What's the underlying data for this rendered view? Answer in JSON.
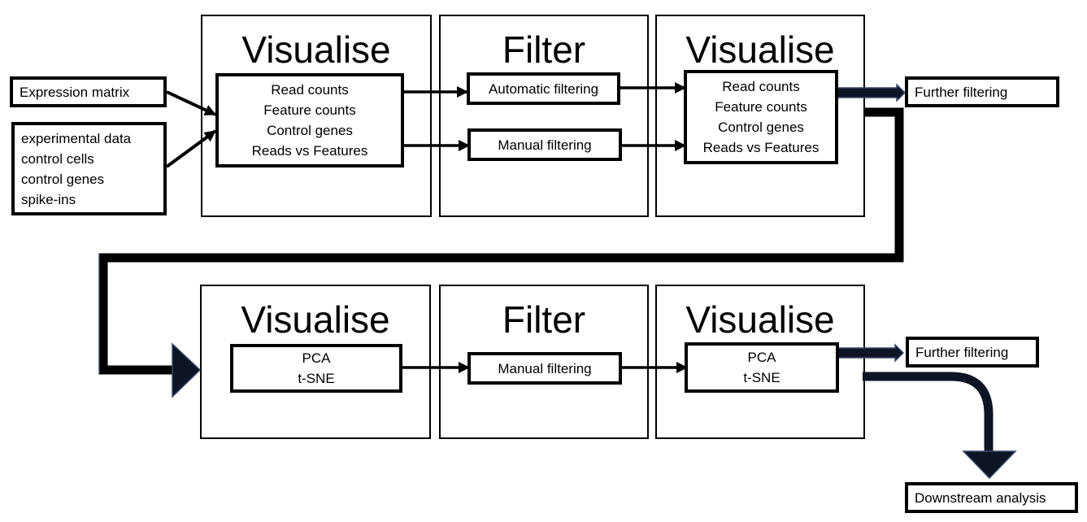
{
  "inputs": {
    "expression_matrix": "Expression matrix",
    "metadata_lines": [
      "experimental data",
      "control cells",
      "control genes",
      "spike-ins"
    ]
  },
  "row1": {
    "stage1": {
      "title": "Visualise",
      "items": [
        "Read counts",
        "Feature counts",
        "Control genes",
        "Reads vs Features"
      ]
    },
    "stage2": {
      "title": "Filter",
      "automatic": "Automatic filtering",
      "manual": "Manual filtering"
    },
    "stage3": {
      "title": "Visualise",
      "items": [
        "Read counts",
        "Feature counts",
        "Control genes",
        "Reads vs Features"
      ]
    },
    "further": "Further filtering"
  },
  "row2": {
    "stage1": {
      "title": "Visualise",
      "items": [
        "PCA",
        "t-SNE"
      ]
    },
    "stage2": {
      "title": "Filter",
      "manual": "Manual filtering"
    },
    "stage3": {
      "title": "Visualise",
      "items": [
        "PCA",
        "t-SNE"
      ]
    },
    "further": "Further filtering",
    "downstream": "Downstream analysis"
  },
  "colors": {
    "stroke": "#000000",
    "thick_arrow_fill": "#0d1424",
    "thick_arrow_outline": "#3b4a6b"
  }
}
